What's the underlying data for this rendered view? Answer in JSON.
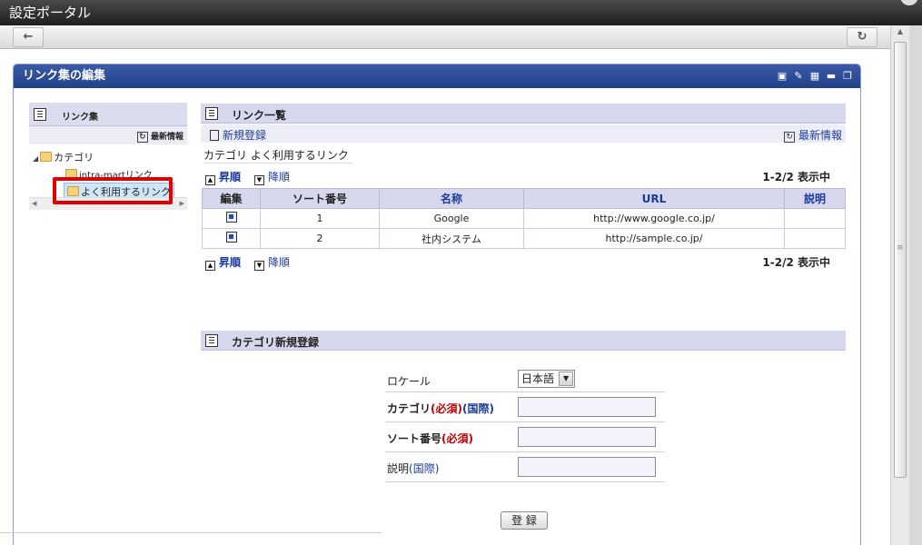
{
  "window": {
    "title": "設定ポータル"
  },
  "nav": {
    "back_icon": "back-arrow-icon",
    "reload_icon": "reload-icon"
  },
  "portlet": {
    "title": "リンク集の編集",
    "icons": [
      "monitor-icon",
      "pencil-icon",
      "settings-icon",
      "minimize-icon",
      "restore-icon"
    ]
  },
  "tree": {
    "title": "リンク集",
    "latest": "最新情報",
    "root": "カテゴリ",
    "children": [
      "intra-martリンク",
      "よく利用するリンク"
    ]
  },
  "list": {
    "title": "リンク一覧",
    "new_registration": "新規登録",
    "latest": "最新情報",
    "category_label": "カテゴリ よく利用するリンク",
    "asc": "昇順",
    "desc": "降順",
    "count": "1-2/2  表示中",
    "columns": [
      "編集",
      "ソート番号",
      "名称",
      "URL",
      "説明"
    ],
    "rows": [
      {
        "sort": "1",
        "name": "Google",
        "url": "http://www.google.co.jp/",
        "desc": ""
      },
      {
        "sort": "2",
        "name": "社内システム",
        "url": "http://sample.co.jp/",
        "desc": ""
      }
    ]
  },
  "category_form": {
    "title": "カテゴリ新規登録",
    "locale_label": "ロケール",
    "locale_value": "日本語",
    "category_label": "カテゴリ",
    "sort_label": "ソート番号",
    "desc_label": "説明",
    "required": "(必須)",
    "intl": "(国際)",
    "submit": "登 録"
  }
}
